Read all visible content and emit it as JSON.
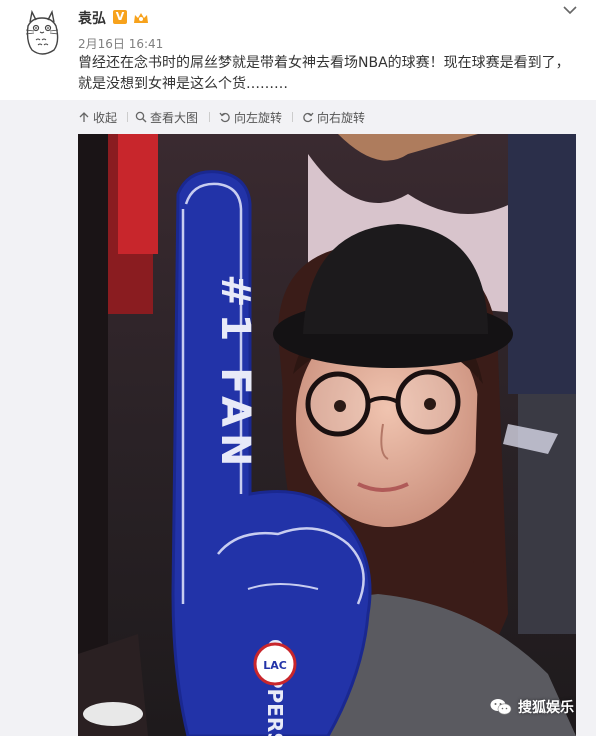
{
  "post": {
    "username": "袁弘",
    "verified_badge": "V",
    "timestamp": "2月16日 16:41",
    "text": "曾经还在念书时的屌丝梦就是带着女神去看场NBA的球赛！现在球赛是看到了，就是没想到女神是这么个货………"
  },
  "toolbar": {
    "collapse_label": "收起",
    "view_large_label": "查看大图",
    "rotate_left_label": "向左旋转",
    "rotate_right_label": "向右旋转"
  },
  "photo": {
    "foam_finger_text": "#1 FAN",
    "team_text": "CLIPPERS",
    "logo_text": "LAC"
  },
  "watermark": {
    "label": "搜狐娱乐"
  },
  "icons": [
    "totoro-avatar-icon",
    "verified-v-icon",
    "crown-icon",
    "chevron-down-icon",
    "collapse-arrow-icon",
    "search-icon",
    "rotate-left-icon",
    "rotate-right-icon",
    "wechat-icon"
  ],
  "colors": {
    "text": "#333333",
    "meta": "#808080",
    "toolbar_bg": "#f2f2f5",
    "badge_orange": "#f7a21c",
    "foam_blue": "#2233a8"
  }
}
